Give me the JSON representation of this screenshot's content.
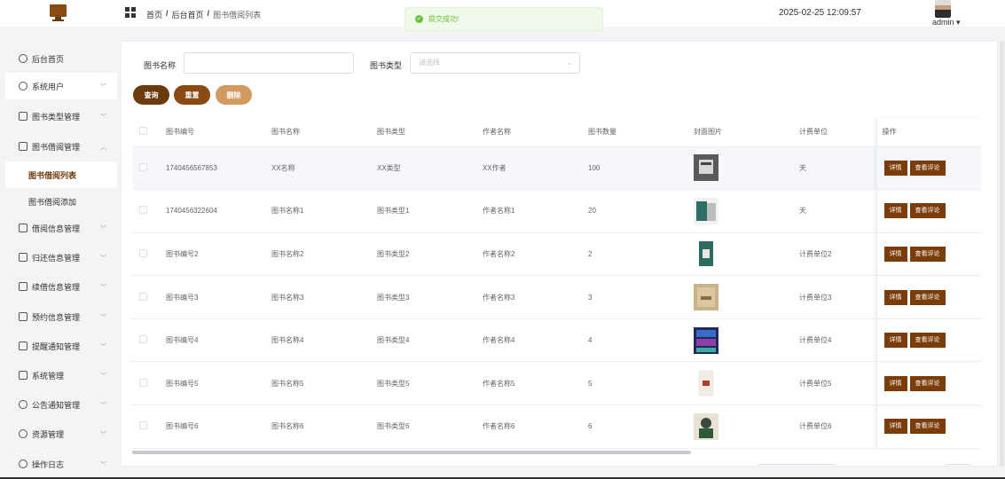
{
  "header": {
    "breadcrumb": [
      "首页",
      "后台首页",
      "图书借阅列表"
    ],
    "datetime": "2025-02-25 12:09:57",
    "user": "admin"
  },
  "toast": {
    "message": "提交成功!"
  },
  "sidebar": {
    "items": [
      {
        "label": "后台首页"
      },
      {
        "label": "系统用户"
      },
      {
        "label": "图书类型管理"
      },
      {
        "label": "图书借阅管理"
      },
      {
        "label": "图书借阅列表"
      },
      {
        "label": "图书借阅添加"
      },
      {
        "label": "借阅信息管理"
      },
      {
        "label": "归还信息管理"
      },
      {
        "label": "续借信息管理"
      },
      {
        "label": "预约信息管理"
      },
      {
        "label": "提醒通知管理"
      },
      {
        "label": "系统管理"
      },
      {
        "label": "公告通知管理"
      },
      {
        "label": "资源管理"
      },
      {
        "label": "操作日志"
      }
    ]
  },
  "search": {
    "name_label": "图书名称",
    "type_label": "图书类型",
    "type_placeholder": "请选择",
    "query_label": "查询",
    "reset_label": "重置",
    "delete_label": "删除"
  },
  "table": {
    "headers": [
      "图书编号",
      "图书名称",
      "图书类型",
      "作者名称",
      "图书数量",
      "封面图片",
      "计费单位",
      "操作"
    ],
    "rows": [
      {
        "code": "1740456567853",
        "name": "XX名称",
        "type": "XX类型",
        "author": "XX作者",
        "qty": "100",
        "unit": "天"
      },
      {
        "code": "1740456322604",
        "name": "图书名称1",
        "type": "图书类型1",
        "author": "作者名称1",
        "qty": "20",
        "unit": "天"
      },
      {
        "code": "图书编号2",
        "name": "图书名称2",
        "type": "图书类型2",
        "author": "作者名称2",
        "qty": "2",
        "unit": "计费单位2"
      },
      {
        "code": "图书编号3",
        "name": "图书名称3",
        "type": "图书类型3",
        "author": "作者名称3",
        "qty": "3",
        "unit": "计费单位3"
      },
      {
        "code": "图书编号4",
        "name": "图书名称4",
        "type": "图书类型4",
        "author": "作者名称4",
        "qty": "4",
        "unit": "计费单位4"
      },
      {
        "code": "图书编号5",
        "name": "图书名称5",
        "type": "图书类型5",
        "author": "作者名称5",
        "qty": "5",
        "unit": "计费单位5"
      },
      {
        "code": "图书编号6",
        "name": "图书名称6",
        "type": "图书类型6",
        "author": "作者名称6",
        "qty": "6",
        "unit": "计费单位6"
      }
    ],
    "detail_label": "详情",
    "review_label": "查看评论"
  },
  "colors": {
    "accent": "#7a3c08",
    "query_btn": "#6b3a0d",
    "reset_btn": "#8a4b12",
    "delete_btn": "#d19a5e"
  }
}
